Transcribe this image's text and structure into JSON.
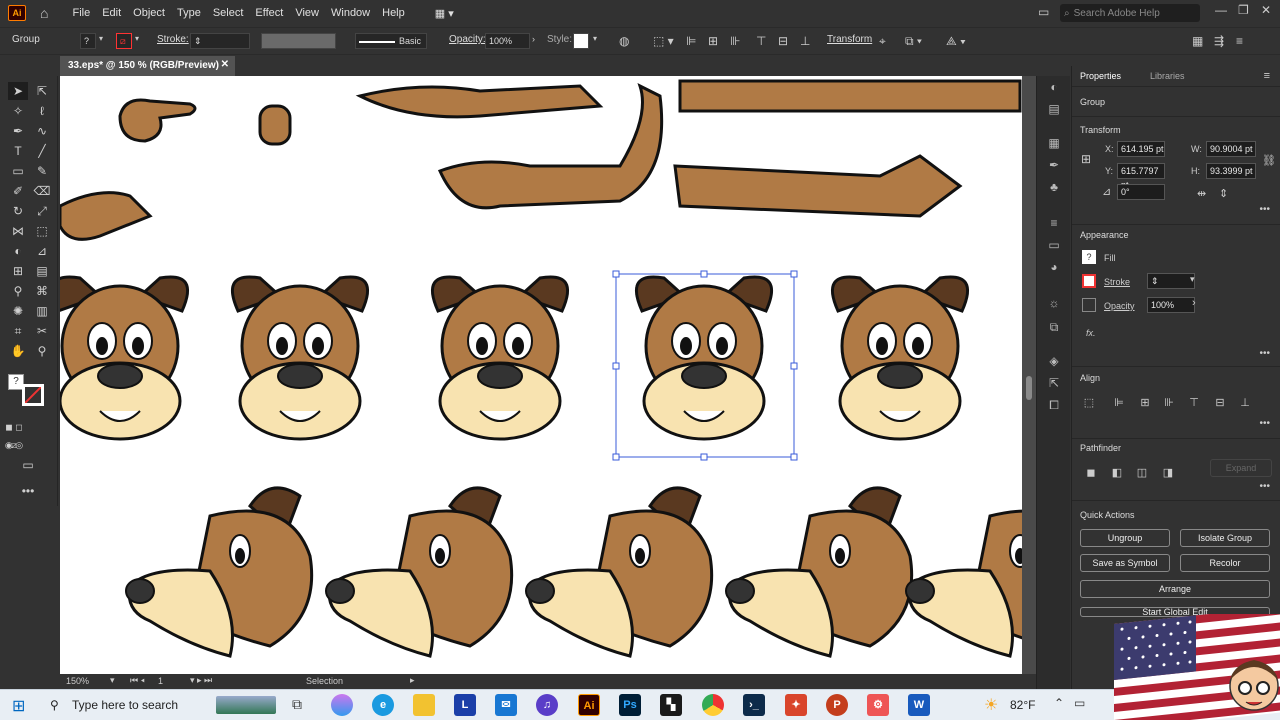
{
  "app": {
    "logo": "Ai"
  },
  "menu": [
    "File",
    "Edit",
    "Object",
    "Type",
    "Select",
    "Effect",
    "View",
    "Window",
    "Help"
  ],
  "search": {
    "placeholder": "Search Adobe Help"
  },
  "control": {
    "selection_type": "Group",
    "stroke_label": "Stroke:",
    "brush_label": "Basic",
    "opacity_label": "Opacity:",
    "opacity_value": "100%",
    "style_label": "Style:",
    "transform_label": "Transform"
  },
  "document": {
    "tab_title": "33.eps* @ 150 % (RGB/Preview)"
  },
  "status": {
    "zoom": "150%",
    "artboard": "1",
    "tool": "Selection"
  },
  "panel": {
    "tabs": [
      "Properties",
      "Libraries"
    ],
    "selection": "Group",
    "transform": {
      "title": "Transform",
      "x_label": "X:",
      "x": "614.195 pt",
      "y_label": "Y:",
      "y": "615.7797 pt",
      "w_label": "W:",
      "w": "90.9004 pt",
      "h_label": "H:",
      "h": "93.3999 pt",
      "angle": "0°"
    },
    "appearance": {
      "title": "Appearance",
      "fill": "Fill",
      "stroke": "Stroke",
      "opacity": "Opacity",
      "opacity_value": "100%",
      "fx": "fx."
    },
    "align": {
      "title": "Align"
    },
    "pathfinder": {
      "title": "Pathfinder",
      "expand": "Expand"
    },
    "quick_actions": {
      "title": "Quick Actions",
      "ungroup": "Ungroup",
      "isolate": "Isolate Group",
      "symbol": "Save as Symbol",
      "recolor": "Recolor",
      "arrange": "Arrange",
      "global_edit": "Start Global Edit"
    }
  },
  "taskbar": {
    "search_placeholder": "Type here to search",
    "weather": "82°F",
    "apps": [
      "L",
      "Ai",
      "Ps"
    ]
  },
  "colors": {
    "accent": "#ff9a00",
    "dog_brown": "#b07a45",
    "dog_dark": "#5a3920",
    "muzzle": "#f8e3b0",
    "selection": "#3a5bd9"
  }
}
